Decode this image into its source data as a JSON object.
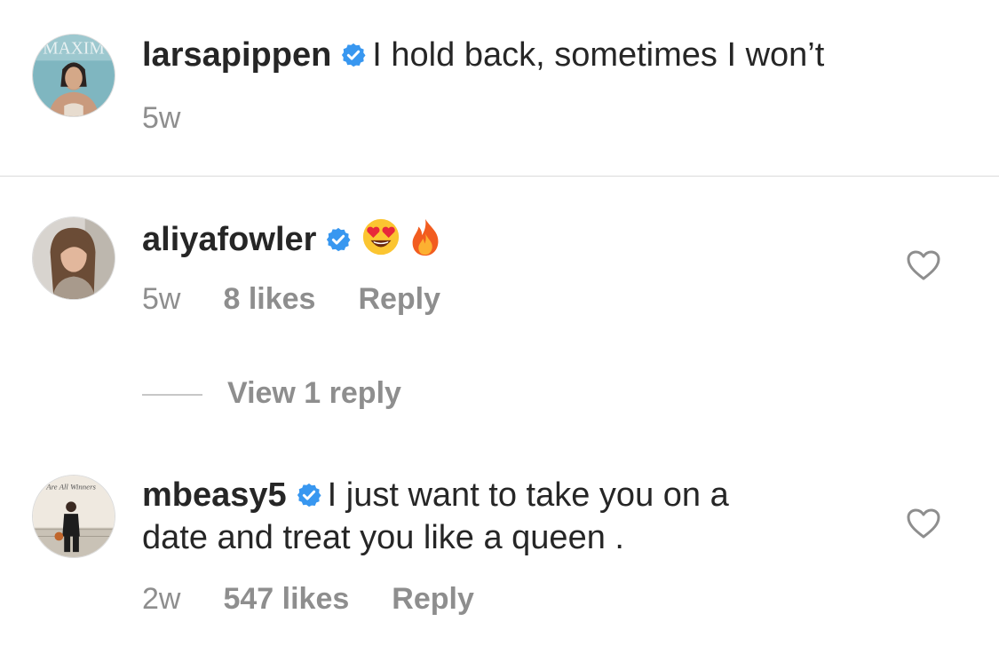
{
  "comments": [
    {
      "username": "larsapippen",
      "text": "I hold back, sometimes I won’t",
      "time": "5w"
    },
    {
      "username": "aliyafowler",
      "emojis": [
        "heart-eyes-emoji",
        "fire-emoji"
      ],
      "time": "5w",
      "likes": "8 likes",
      "reply_label": "Reply",
      "view_replies_label": "View 1 reply"
    },
    {
      "username": "mbeasy5",
      "text_line1": "I just want to take you on a",
      "text_line2": "date and treat you like a queen .",
      "time": "2w",
      "likes": "547 likes",
      "reply_label": "Reply",
      "avatar_text": "Are All Winners"
    }
  ],
  "avatar_1_text": "MAXIM",
  "colors": {
    "verified": "#3897f0",
    "muted": "#8e8e8e",
    "text": "#262626",
    "divider": "#dbdbdb"
  }
}
